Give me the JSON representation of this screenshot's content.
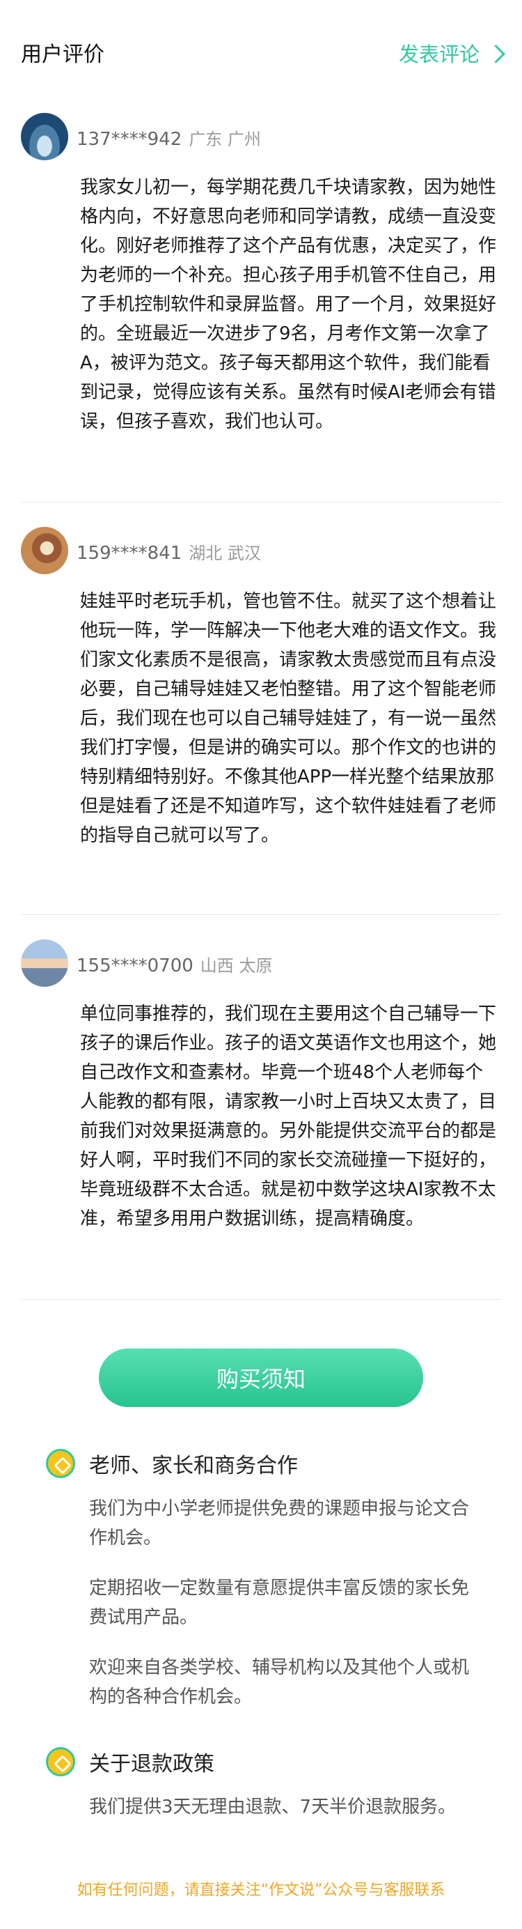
{
  "header": {
    "title": "用户评价",
    "action": "发表评论"
  },
  "reviews": [
    {
      "user": "137****942",
      "location": "广东 广州",
      "text": "我家女儿初一，每学期花费几千块请家教，因为她性格内向，不好意思向老师和同学请教，成绩一直没变化。刚好老师推荐了这个产品有优惠，决定买了，作为老师的一个补充。担心孩子用手机管不住自己，用了手机控制软件和录屏监督。用了一个月，效果挺好的。全班最近一次进步了9名，月考作文第一次拿了A，被评为范文。孩子每天都用这个软件，我们能看到记录，觉得应该有关系。虽然有时候AI老师会有错误，但孩子喜欢，我们也认可。"
    },
    {
      "user": "159****841",
      "location": "湖北 武汉",
      "text": "娃娃平时老玩手机，管也管不住。就买了这个想着让他玩一阵，学一阵解决一下他老大难的语文作文。我们家文化素质不是很高，请家教太贵感觉而且有点没必要，自己辅导娃娃又老怕整错。用了这个智能老师后，我们现在也可以自己辅导娃娃了，有一说一虽然我们打字慢，但是讲的确实可以。那个作文的也讲的特别精细特别好。不像其他APP一样光整个结果放那但是娃看了还是不知道咋写，这个软件娃娃看了老师的指导自己就可以写了。"
    },
    {
      "user": "155****0700",
      "location": "山西 太原",
      "text": "单位同事推荐的，我们现在主要用这个自己辅导一下孩子的课后作业。孩子的语文英语作文也用这个，她自己改作文和查素材。毕竟一个班48个人老师每个人能教的都有限，请家教一小时上百块又太贵了，目前我们对效果挺满意的。另外能提供交流平台的都是好人啊，平时我们不同的家长交流碰撞一下挺好的，毕竟班级群不太合适。就是初中数学这块AI家教不太准，希望多用用户数据训练，提高精确度。"
    }
  ],
  "buy_button": "购买须知",
  "sections": [
    {
      "title": "老师、家长和商务合作",
      "paragraphs": [
        "我们为中小学老师提供免费的课题申报与论文合作机会。",
        "定期招收一定数量有意愿提供丰富反馈的家长免费试用产品。",
        "欢迎来自各类学校、辅导机构以及其他个人或机构的各种合作机会。"
      ]
    },
    {
      "title": "关于退款政策",
      "paragraphs": [
        "我们提供3天无理由退款、7天半价退款服务。"
      ]
    }
  ],
  "footer": "如有任何问题，请直接关注“作文说”公众号与客服联系",
  "colors": {
    "accent": "#2fc9a0",
    "footer": "#f0a623"
  }
}
